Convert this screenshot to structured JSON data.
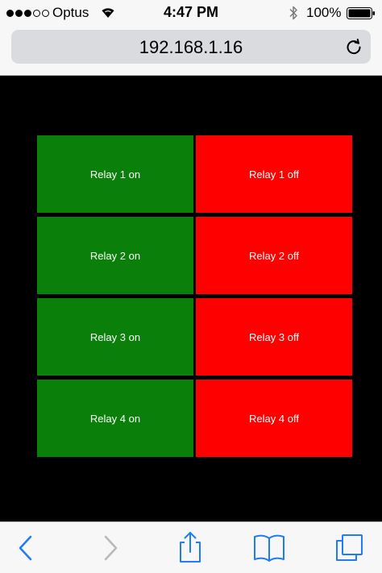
{
  "status_bar": {
    "carrier": "Optus",
    "time": "4:47 PM",
    "battery": "100%",
    "signal_bars_filled": 3,
    "signal_bars_total": 5
  },
  "address_bar": {
    "url": "192.168.1.16"
  },
  "relays": [
    {
      "on_label": "Relay 1 on",
      "off_label": "Relay 1 off"
    },
    {
      "on_label": "Relay 2 on",
      "off_label": "Relay 2 off"
    },
    {
      "on_label": "Relay 3 on",
      "off_label": "Relay 3 off"
    },
    {
      "on_label": "Relay 4 on",
      "off_label": "Relay 4 off"
    }
  ],
  "colors": {
    "on": "#0a800a",
    "off": "#ff0000",
    "page_background": "#000000",
    "toolbar_tint": "#1d7cf6",
    "toolbar_disabled": "#b8b8bc"
  },
  "icons": {
    "status": [
      "wifi-icon",
      "bluetooth-icon",
      "battery-icon"
    ],
    "address": [
      "reload-icon"
    ],
    "toolbar": [
      "back-icon",
      "forward-icon",
      "share-icon",
      "bookmarks-icon",
      "tabs-icon"
    ]
  }
}
